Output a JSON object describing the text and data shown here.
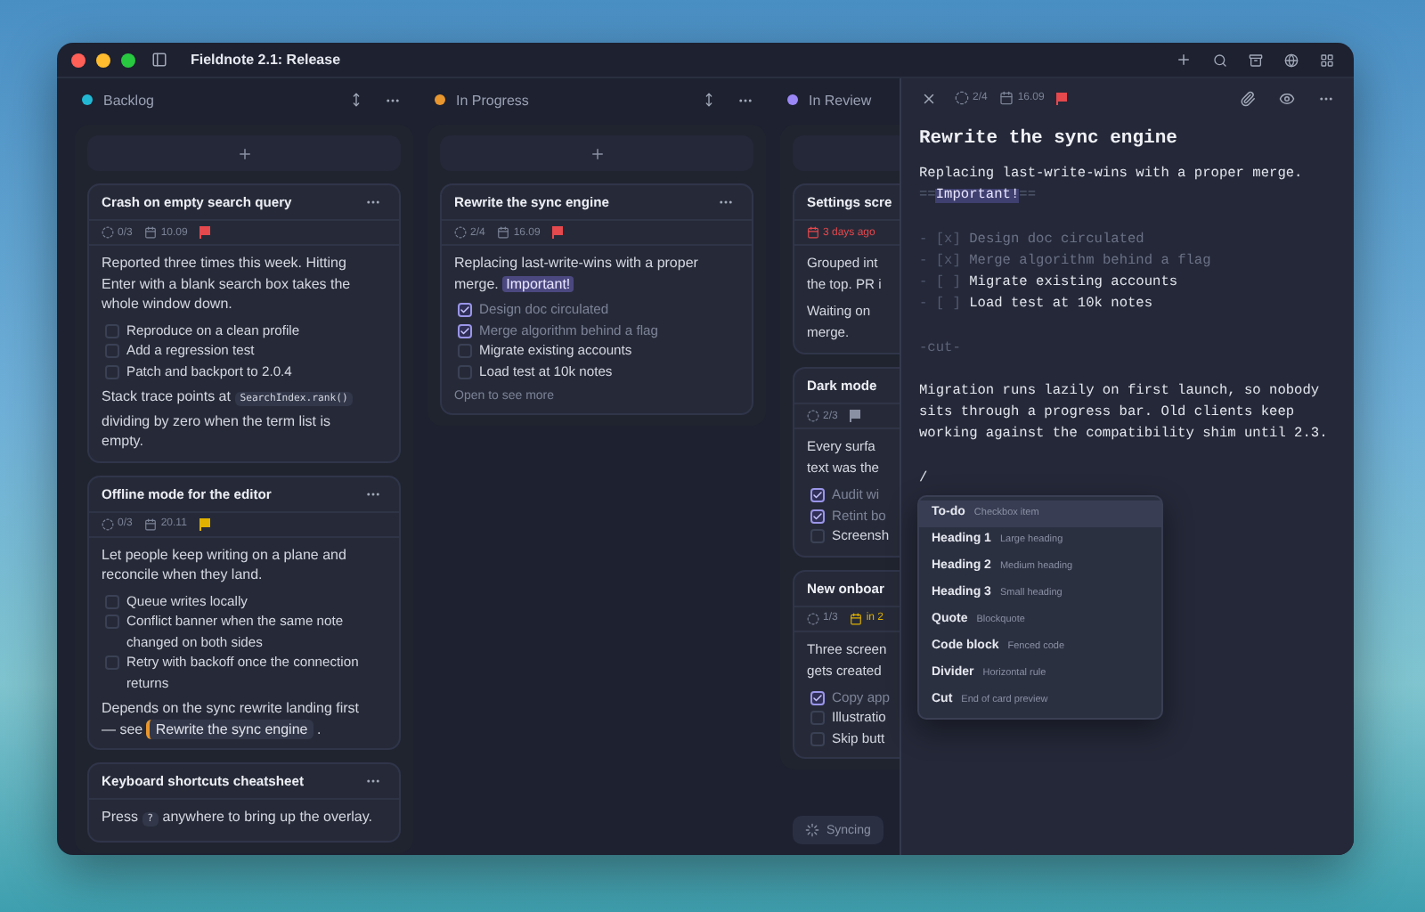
{
  "window": {
    "title": "Fieldnote 2.1: Release"
  },
  "columns": [
    {
      "name": "Backlog",
      "color": "#22b8d4",
      "cards": [
        {
          "title": "Crash on empty search query",
          "progress": "0/3",
          "date": "10.09",
          "overdue": false,
          "due_soon": false,
          "flag": {
            "color": "#e5484d"
          },
          "body": [
            {
              "kind": "text",
              "segments": [
                {
                  "kind": "text",
                  "text": "Reported three times this week. Hitting Enter with a blank search box takes the whole window down."
                }
              ]
            },
            {
              "kind": "tasks",
              "items": [
                {
                  "text": "Reproduce on a clean profile",
                  "checked": false
                },
                {
                  "text": "Add a regression test",
                  "checked": false
                },
                {
                  "text": "Patch and backport to 2.0.4",
                  "checked": false
                }
              ]
            },
            {
              "kind": "text",
              "segments": [
                {
                  "kind": "text",
                  "text": "Stack trace points at "
                },
                {
                  "kind": "code",
                  "text": "SearchIndex.rank()"
                },
                {
                  "kind": "text",
                  "text": " dividing by zero when the term list is empty."
                }
              ]
            }
          ]
        },
        {
          "title": "Offline mode for the editor",
          "progress": "0/3",
          "date": "20.11",
          "overdue": false,
          "due_soon": false,
          "flag": {
            "color": "#e0b100"
          },
          "body": [
            {
              "kind": "text",
              "segments": [
                {
                  "kind": "text",
                  "text": "Let people keep writing on a plane and reconcile when they land."
                }
              ]
            },
            {
              "kind": "tasks",
              "items": [
                {
                  "text": "Queue writes locally",
                  "checked": false
                },
                {
                  "text": "Conflict banner when the same note changed on both sides",
                  "checked": false
                },
                {
                  "text": "Retry with backoff once the connection returns",
                  "checked": false
                }
              ]
            },
            {
              "kind": "text",
              "segments": [
                {
                  "kind": "text",
                  "text": "Depends on the sync rewrite landing first — see "
                },
                {
                  "kind": "link",
                  "text": "Rewrite the sync engine"
                },
                {
                  "kind": "text",
                  "text": " ."
                }
              ]
            }
          ]
        },
        {
          "title": "Keyboard shortcuts cheatsheet",
          "body": [
            {
              "kind": "text",
              "segments": [
                {
                  "kind": "text",
                  "text": "Press "
                },
                {
                  "kind": "code",
                  "text": "?"
                },
                {
                  "kind": "text",
                  "text": " anywhere to bring up the overlay."
                }
              ]
            }
          ]
        }
      ]
    },
    {
      "name": "In Progress",
      "color": "#e8962e",
      "cards": [
        {
          "title": "Rewrite the sync engine",
          "progress": "2/4",
          "date": "16.09",
          "overdue": false,
          "due_soon": false,
          "flag": {
            "color": "#e5484d"
          },
          "footer": "Open to see more",
          "body": [
            {
              "kind": "text",
              "segments": [
                {
                  "kind": "text",
                  "text": "Replacing last-write-wins with a proper merge. "
                },
                {
                  "kind": "highlight",
                  "text": "Important!"
                }
              ]
            },
            {
              "kind": "tasks",
              "items": [
                {
                  "text": "Design doc circulated",
                  "checked": true
                },
                {
                  "text": "Merge algorithm behind a flag",
                  "checked": true
                },
                {
                  "text": "Migrate existing accounts",
                  "checked": false
                },
                {
                  "text": "Load test at 10k notes",
                  "checked": false
                }
              ]
            }
          ]
        }
      ]
    },
    {
      "name": "In Review",
      "color": "#9b87f5",
      "cards": [
        {
          "title": "Settings scre",
          "date": "3 days ago",
          "overdue": true,
          "due_soon": false,
          "body": [
            {
              "kind": "lines",
              "lines": [
                "Grouped int",
                "the top. PR i"
              ]
            },
            {
              "kind": "lines",
              "lines": [
                "Waiting on",
                "merge."
              ]
            }
          ]
        },
        {
          "title": "Dark mode",
          "progress": "2/3",
          "flag": {
            "color": "#8a90a3"
          },
          "body": [
            {
              "kind": "lines",
              "lines": [
                "Every surfa",
                "text was the"
              ]
            },
            {
              "kind": "tasks",
              "items": [
                {
                  "text": "Audit wi",
                  "checked": true
                },
                {
                  "text": "Retint bo",
                  "checked": true
                },
                {
                  "text": "Screensh",
                  "checked": false
                }
              ]
            }
          ]
        },
        {
          "title": "New onboar",
          "progress": "1/3",
          "date": "in 2",
          "overdue": false,
          "due_soon": true,
          "body": [
            {
              "kind": "lines",
              "lines": [
                "Three screen",
                "gets created"
              ]
            },
            {
              "kind": "tasks",
              "items": [
                {
                  "text": "Copy app",
                  "checked": true
                },
                {
                  "text": "Illustratio",
                  "checked": false
                },
                {
                  "text": "Skip butt",
                  "checked": false
                }
              ]
            }
          ]
        }
      ]
    }
  ],
  "sync_status": {
    "label": "Syncing"
  },
  "editor": {
    "progress": "2/4",
    "date": "16.09",
    "flag": {
      "color": "#e5484d"
    },
    "title": "Rewrite the sync engine",
    "lines": [
      {
        "kind": "paragraph",
        "segments": [
          {
            "kind": "text",
            "text": "Replacing last-write-wins with a proper merge. "
          },
          {
            "kind": "marker",
            "text": "=="
          },
          {
            "kind": "highlight",
            "text": "Important!"
          },
          {
            "kind": "marker",
            "text": "=="
          }
        ]
      },
      {
        "kind": "blank"
      },
      {
        "kind": "task",
        "marker": "- [x]",
        "text": "Design doc circulated",
        "checked": true
      },
      {
        "kind": "task",
        "marker": "- [x]",
        "text": "Merge algorithm behind a flag",
        "checked": true
      },
      {
        "kind": "task",
        "marker": "- [ ]",
        "text": "Migrate existing accounts",
        "checked": false
      },
      {
        "kind": "task",
        "marker": "- [ ]",
        "text": "Load test at 10k notes",
        "checked": false
      },
      {
        "kind": "blank"
      },
      {
        "kind": "cut",
        "text": "-cut-"
      },
      {
        "kind": "blank"
      },
      {
        "kind": "paragraph",
        "segments": [
          {
            "kind": "text",
            "text": "Migration runs lazily on first launch, so nobody sits through a progress bar. Old clients keep working against the compatibility shim until 2.3."
          }
        ]
      },
      {
        "kind": "blank"
      },
      {
        "kind": "command",
        "text": "/"
      }
    ],
    "slash_menu": [
      {
        "label": "To-do",
        "hint": "Checkbox item",
        "selected": true
      },
      {
        "label": "Heading 1",
        "hint": "Large heading",
        "selected": false
      },
      {
        "label": "Heading 2",
        "hint": "Medium heading",
        "selected": false
      },
      {
        "label": "Heading 3",
        "hint": "Small heading",
        "selected": false
      },
      {
        "label": "Quote",
        "hint": "Blockquote",
        "selected": false
      },
      {
        "label": "Code block",
        "hint": "Fenced code",
        "selected": false
      },
      {
        "label": "Divider",
        "hint": "Horizontal rule",
        "selected": false
      },
      {
        "label": "Cut",
        "hint": "End of card preview",
        "selected": false
      }
    ]
  }
}
